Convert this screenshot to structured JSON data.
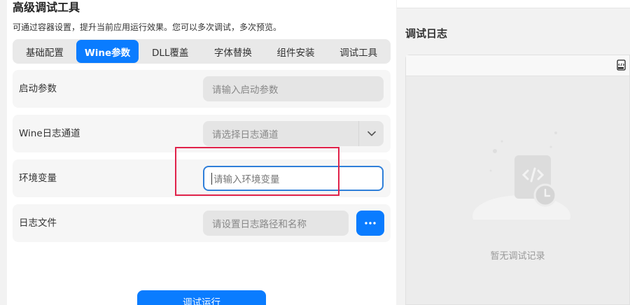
{
  "header": {
    "title": "高级调试工具",
    "description": "可通过容器设置，提升当前应用运行效果。您可以多次调试，多次预览。"
  },
  "tabs": [
    {
      "label": "基础配置",
      "active": false
    },
    {
      "label": "Wine参数",
      "active": true
    },
    {
      "label": "DLL覆盖",
      "active": false
    },
    {
      "label": "字体替换",
      "active": false
    },
    {
      "label": "组件安装",
      "active": false
    },
    {
      "label": "调试工具",
      "active": false
    }
  ],
  "form": {
    "launch_params": {
      "label": "启动参数",
      "placeholder": "请输入启动参数"
    },
    "log_channel": {
      "label": "Wine日志通道",
      "placeholder": "请选择日志通道"
    },
    "env_vars": {
      "label": "环境变量",
      "placeholder": "请输入环境变量"
    },
    "log_file": {
      "label": "日志文件",
      "placeholder": "请设置日志路径和名称"
    }
  },
  "actions": {
    "run_label": "调试运行"
  },
  "log": {
    "title": "调试日志",
    "empty_text": "暂无调试记录"
  },
  "colors": {
    "accent": "#0a7cff",
    "highlight": "#e0224a",
    "focus_border": "#2f7fd9"
  },
  "icons": {
    "toolbar": "code-file-icon",
    "more": "ellipsis-icon",
    "dropdown": "chevron-down-icon"
  }
}
